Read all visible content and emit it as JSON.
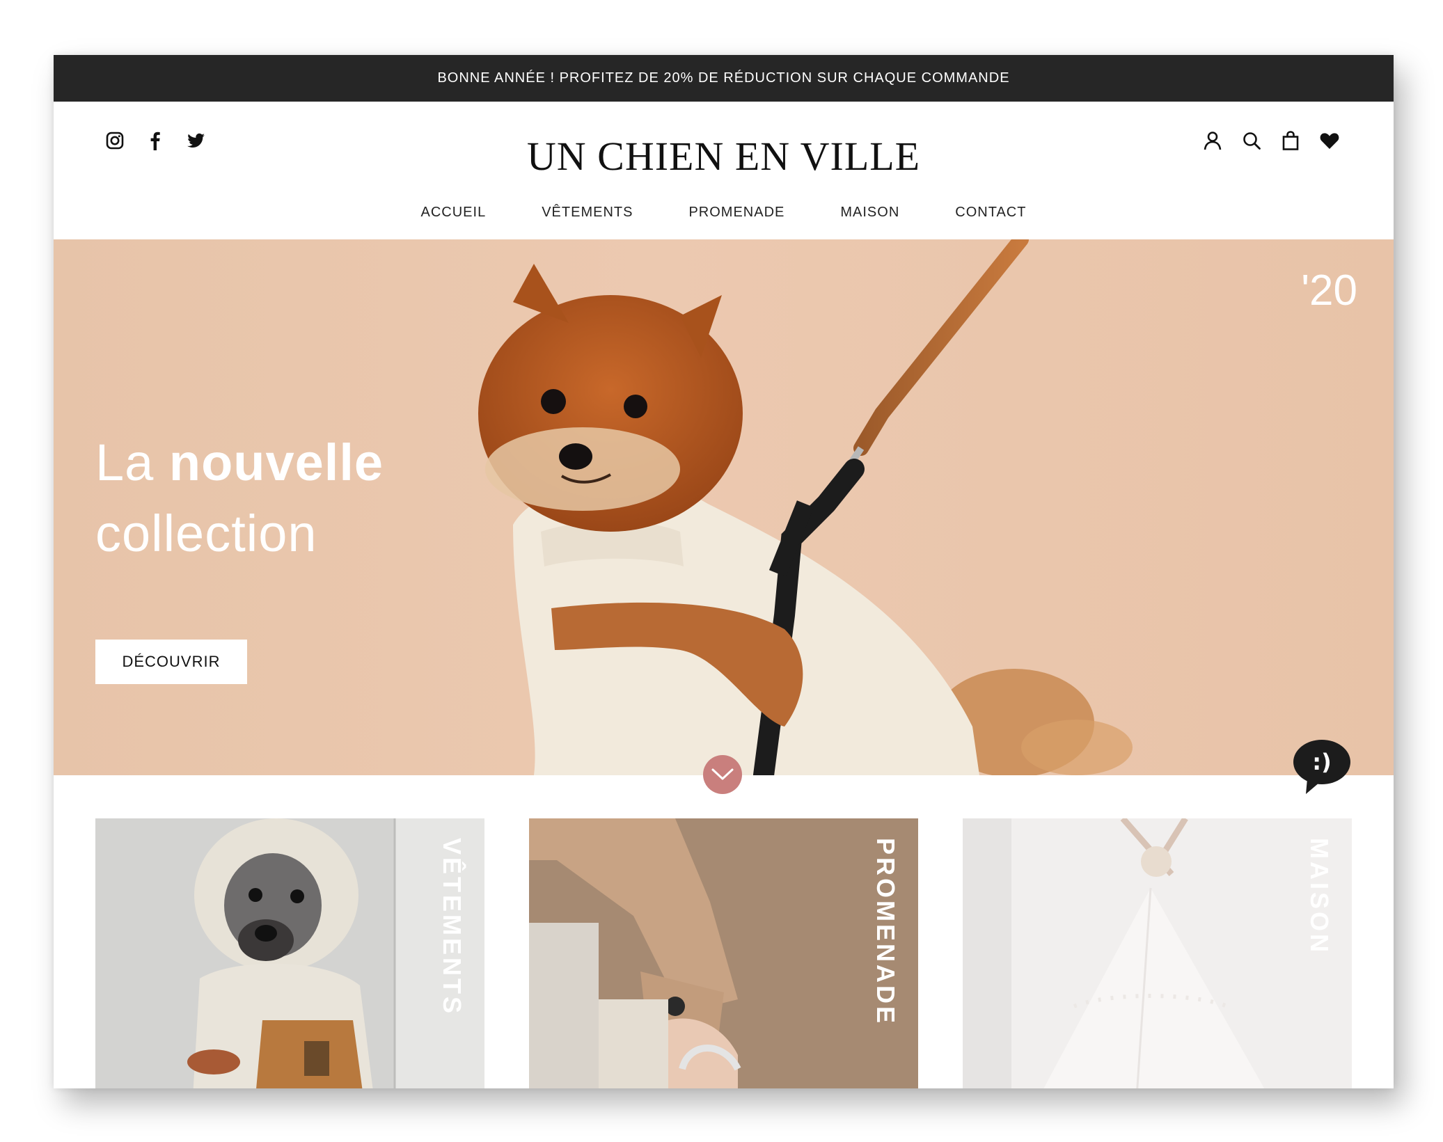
{
  "announcement": "BONNE ANNÉE ! PROFITEZ DE 20% DE RÉDUCTION SUR CHAQUE COMMANDE",
  "brand": "UN CHIEN EN VILLE",
  "social_icons": [
    "instagram-icon",
    "facebook-icon",
    "twitter-icon"
  ],
  "header_tools": [
    "account-icon",
    "search-icon",
    "shopping-bag-icon",
    "wishlist-heart-icon"
  ],
  "nav": {
    "items": [
      "ACCUEIL",
      "VÊTEMENTS",
      "PROMENADE",
      "MAISON",
      "CONTACT"
    ]
  },
  "hero": {
    "year": "'20",
    "headline_light": "La",
    "headline_bold": "nouvelle",
    "headline_line2": "collection",
    "cta_label": "DÉCOUVRIR"
  },
  "scroll_button_icon": "chevron-down-icon",
  "chat_widget": {
    "icon": "chat-bubble-icon",
    "text": ":)"
  },
  "categories": [
    {
      "label": "VÊTEMENTS"
    },
    {
      "label": "PROMENADE"
    },
    {
      "label": "MAISON"
    }
  ],
  "colors": {
    "announcement_bg": "#262626",
    "hero_bg": "#e8c6ab",
    "scroll_button": "#c97f7d",
    "text_dark": "#111111"
  }
}
